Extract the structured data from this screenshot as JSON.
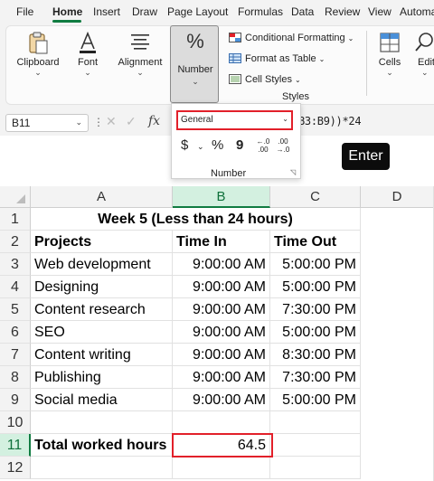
{
  "menu": {
    "items": [
      "File",
      "Home",
      "Insert",
      "Draw",
      "Page Layout",
      "Formulas",
      "Data",
      "Review",
      "View",
      "Automa"
    ],
    "active": "Home"
  },
  "ribbon": {
    "clipboard_label": "Clipboard",
    "font_label": "Font",
    "alignment_label": "Alignment",
    "number_label": "Number",
    "conditional_formatting": "Conditional Formatting",
    "format_as_table": "Format as Table",
    "cell_styles": "Cell Styles",
    "styles_label": "Styles",
    "cells_label": "Cells",
    "editing_label": "Edit",
    "percent_symbol": "%"
  },
  "formula_bar": {
    "name_box": "B11",
    "formula_visible": "B3:B9))*24",
    "fx": "fx"
  },
  "number_panel": {
    "format_value": "General",
    "currency_symbol": "$",
    "percent_symbol": "%",
    "comma_symbol": "9",
    "increase_decimal": "←.0 .00",
    "decrease_decimal": ".00 →.0",
    "label": "Number"
  },
  "key_overlay": "Enter",
  "sheet": {
    "columns": [
      "A",
      "B",
      "C",
      "D"
    ],
    "selected_column": "B",
    "rows": [
      "1",
      "2",
      "3",
      "4",
      "5",
      "6",
      "7",
      "8",
      "9",
      "10",
      "11",
      "12"
    ],
    "selected_row": "11",
    "title": "Week 5 (Less than 24 hours)",
    "headers": {
      "projects": "Projects",
      "time_in": "Time In",
      "time_out": "Time Out"
    },
    "data": [
      {
        "project": "Web development",
        "time_in": "9:00:00 AM",
        "time_out": "5:00:00 PM"
      },
      {
        "project": "Designing",
        "time_in": "9:00:00 AM",
        "time_out": "5:00:00 PM"
      },
      {
        "project": "Content research",
        "time_in": "9:00:00 AM",
        "time_out": "7:30:00 PM"
      },
      {
        "project": "SEO",
        "time_in": "9:00:00 AM",
        "time_out": "5:00:00 PM"
      },
      {
        "project": "Content writing",
        "time_in": "9:00:00 AM",
        "time_out": "8:30:00 PM"
      },
      {
        "project": "Publishing",
        "time_in": "9:00:00 AM",
        "time_out": "7:30:00 PM"
      },
      {
        "project": "Social media",
        "time_in": "9:00:00 AM",
        "time_out": "5:00:00 PM"
      }
    ],
    "total_label": "Total worked hours",
    "total_value": "64.5"
  },
  "colors": {
    "accent_green": "#107c41",
    "highlight_red": "#e2202a",
    "selected_header_bg": "#d3f0e0"
  }
}
